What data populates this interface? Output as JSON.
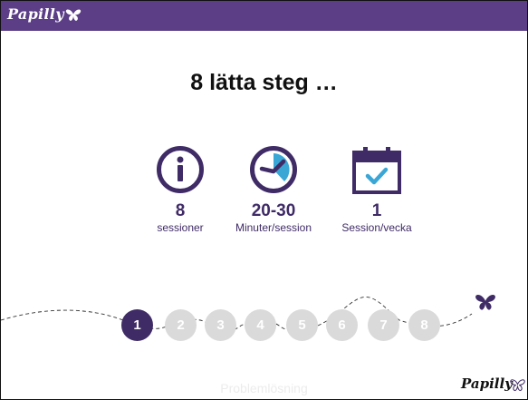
{
  "brand": {
    "name": "Papilly",
    "icon": "butterfly-icon"
  },
  "title": "8 lätta steg …",
  "stats": [
    {
      "icon": "info-icon",
      "value": "8",
      "label": "sessioner"
    },
    {
      "icon": "clock-icon",
      "value": "20-30",
      "label": "Minuter/session"
    },
    {
      "icon": "calendar-check-icon",
      "value": "1",
      "label": "Session/vecka"
    }
  ],
  "steps": [
    "1",
    "2",
    "3",
    "4",
    "5",
    "6",
    "7",
    "8"
  ],
  "active_step": 1,
  "bottom_label": "Problemlösning",
  "footer_brand": "Papilly",
  "colors": {
    "purple": "#5b3e86",
    "dark_purple": "#3f2b66",
    "step_inactive": "#dadada",
    "accent_blue": "#3aa6d6"
  }
}
